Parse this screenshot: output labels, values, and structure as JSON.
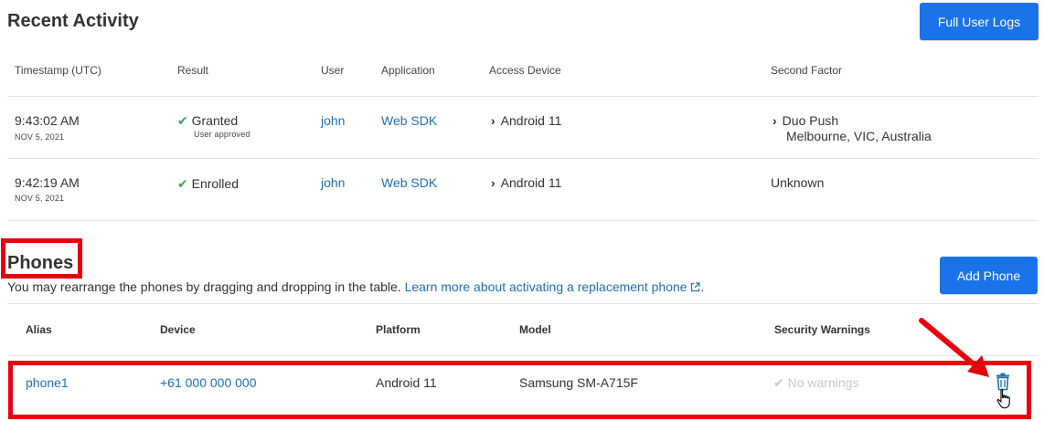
{
  "recent_activity": {
    "title": "Recent Activity",
    "logs_button": "Full User Logs",
    "columns": [
      "Timestamp (UTC)",
      "Result",
      "User",
      "Application",
      "Access Device",
      "Second Factor"
    ],
    "rows": [
      {
        "time": "9:43:02 AM",
        "date": "NOV 5, 2021",
        "result": "Granted",
        "result_sub": "User approved",
        "user": "john",
        "application": "Web SDK",
        "device": "Android 11",
        "factor": "Duo Push",
        "factor_location": "Melbourne, VIC, Australia"
      },
      {
        "time": "9:42:19 AM",
        "date": "NOV 5, 2021",
        "result": "Enrolled",
        "user": "john",
        "application": "Web SDK",
        "device": "Android 11",
        "factor": "Unknown"
      }
    ]
  },
  "phones": {
    "title": "Phones",
    "description": "You may rearrange the phones by dragging and dropping in the table.",
    "learn_more_link": "Learn more about activating a replacement phone",
    "trailing_period": ".",
    "add_button": "Add Phone",
    "columns": [
      "Alias",
      "Device",
      "Platform",
      "Model",
      "Security Warnings"
    ],
    "rows": [
      {
        "alias": "phone1",
        "device": "+61 000 000 000",
        "platform": "Android 11",
        "model": "Samsung SM-A715F",
        "warnings": "No warnings"
      }
    ]
  },
  "icons": {
    "check": "check-icon",
    "chevron": "chevron-right-icon",
    "external": "external-link-icon",
    "trash": "trash-icon",
    "cursor": "hand-cursor-icon",
    "arrow": "red-arrow-annotation"
  },
  "colors": {
    "accent": "#1a73e8",
    "link": "#1f6fb5",
    "success": "#3aa655",
    "annotation": "#e8000b"
  }
}
